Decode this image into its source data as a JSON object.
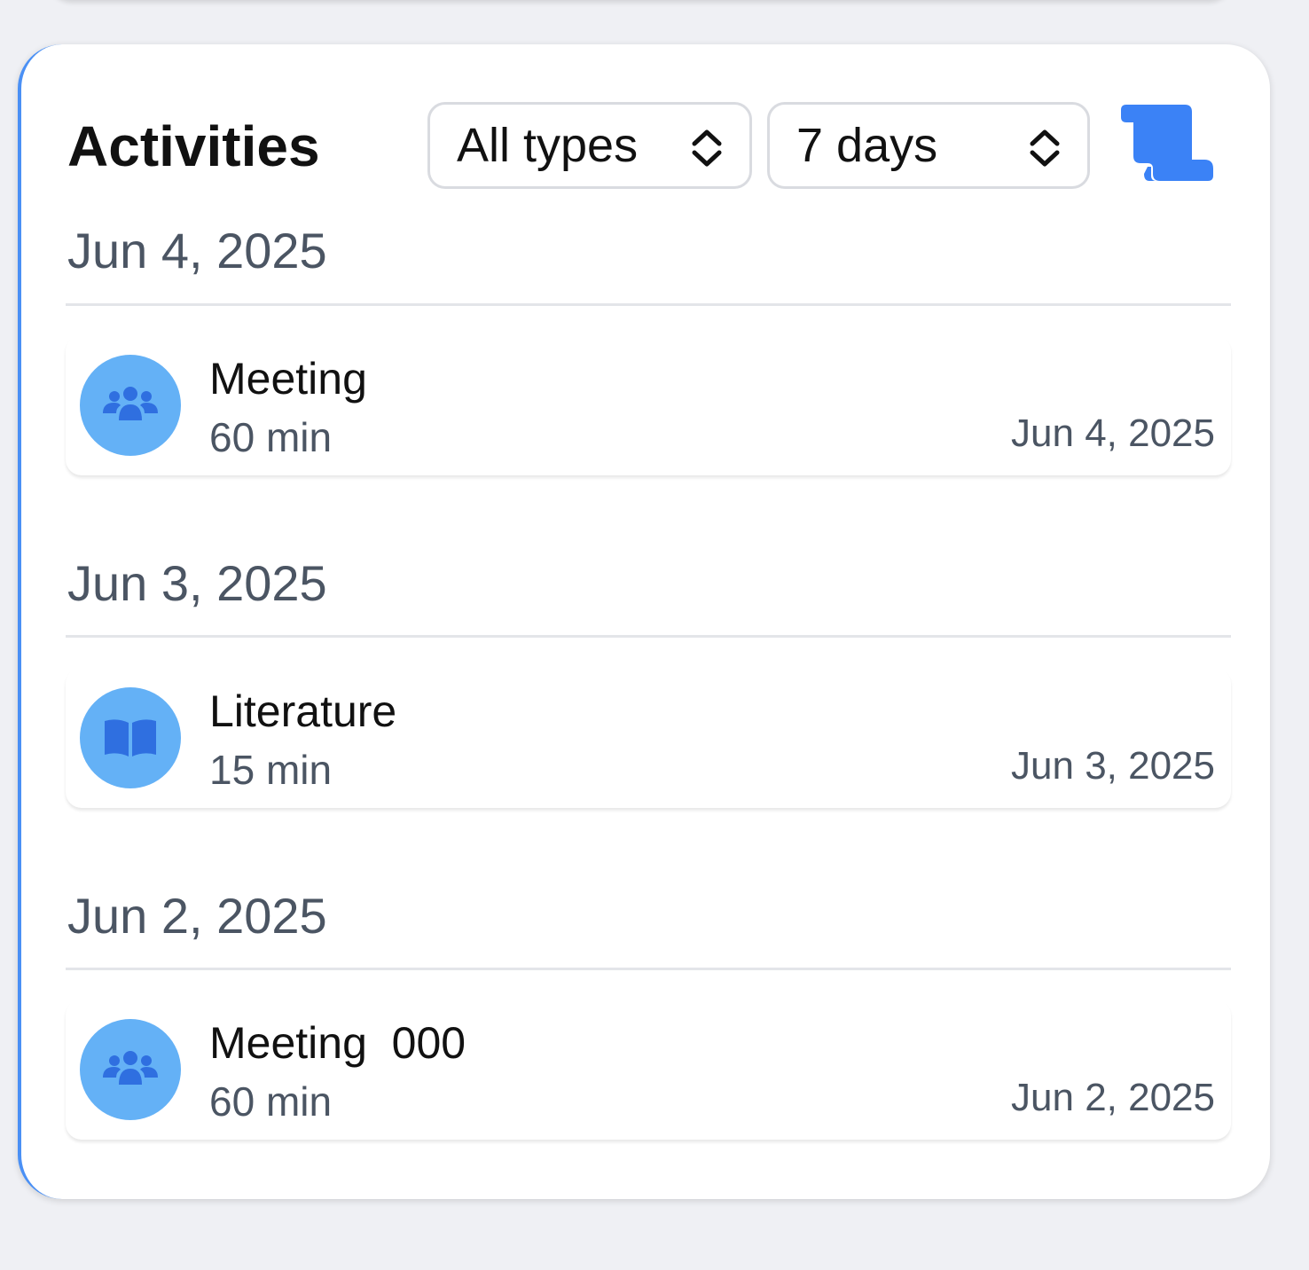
{
  "header": {
    "title": "Activities",
    "type_filter": "All types",
    "range_filter": "7 days"
  },
  "groups": [
    {
      "date": "Jun 4, 2025",
      "items": [
        {
          "title": "Meeting",
          "duration": "60 min",
          "date": "Jun 4, 2025",
          "icon": "people-icon"
        }
      ]
    },
    {
      "date": "Jun 3, 2025",
      "items": [
        {
          "title": "Literature",
          "duration": "15 min",
          "date": "Jun 3, 2025",
          "icon": "book-icon"
        }
      ]
    },
    {
      "date": "Jun 2, 2025",
      "items": [
        {
          "title": "Meeting  000",
          "duration": "60 min",
          "date": "Jun 2, 2025",
          "icon": "people-icon"
        }
      ]
    }
  ],
  "colors": {
    "accent": "#3b82f6",
    "avatar_bg": "#64b1f6",
    "icon_fg": "#2f6fe0"
  }
}
